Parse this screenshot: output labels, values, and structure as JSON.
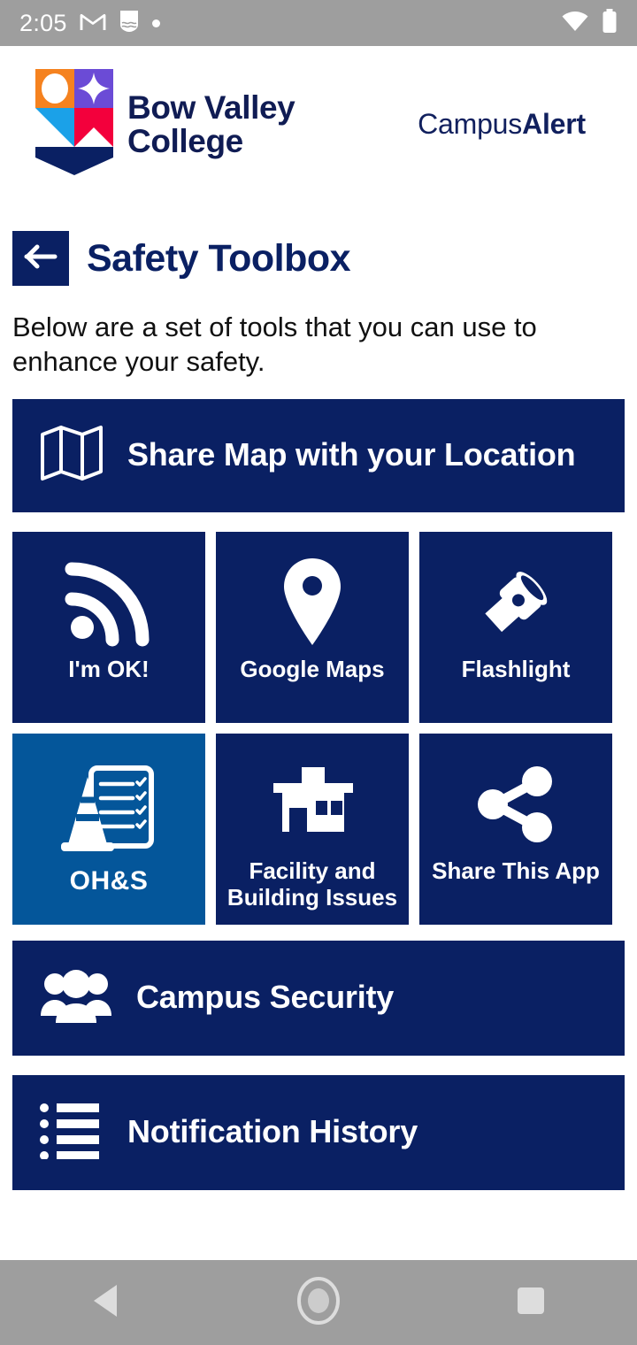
{
  "status_bar": {
    "time": "2:05",
    "icons": [
      "gmail-icon",
      "shield-app-icon",
      "dot-icon"
    ],
    "right_icons": [
      "wifi-icon",
      "battery-icon"
    ]
  },
  "header": {
    "logo_line1": "Bow Valley",
    "logo_line2": "College",
    "logo_text": "Bow Valley\nCollege",
    "brand_regular": "Campus",
    "brand_bold": "Alert",
    "colors": {
      "navy": "#0A2063",
      "logo_navy": "#101C54",
      "crest_orange": "#F5821F",
      "crest_purple": "#6B4BD6",
      "crest_lightblue": "#1BA1E8",
      "crest_red": "#F3003C"
    }
  },
  "page": {
    "back_icon": "arrow-left-icon",
    "title": "Safety Toolbox",
    "intro": "Below are a set of tools that you can use to enhance your safety."
  },
  "actions": {
    "share_map": {
      "label": "Share Map with your Location",
      "icon": "map-icon"
    },
    "campus_security": {
      "label": "Campus Security",
      "icon": "people-group-icon"
    },
    "notification_history": {
      "label": "Notification History",
      "icon": "list-bullets-icon"
    }
  },
  "tiles": [
    {
      "label": "I'm OK!",
      "icon": "rss-signal-icon",
      "bg": "#0A2063"
    },
    {
      "label": "Google Maps",
      "icon": "map-pin-icon",
      "bg": "#0A2063"
    },
    {
      "label": "Flashlight",
      "icon": "flashlight-icon",
      "bg": "#0A2063"
    },
    {
      "label": "OH&S",
      "icon": "cone-checklist-icon",
      "bg": "#04569A"
    },
    {
      "label": "Facility and Building Issues",
      "icon": "building-icon",
      "bg": "#0A2063"
    },
    {
      "label": "Share This App",
      "icon": "share-nodes-icon",
      "bg": "#0A2063"
    }
  ],
  "nav_bar": {
    "back": "triangle-back-icon",
    "home": "circle-home-icon",
    "recents": "square-recents-icon"
  }
}
